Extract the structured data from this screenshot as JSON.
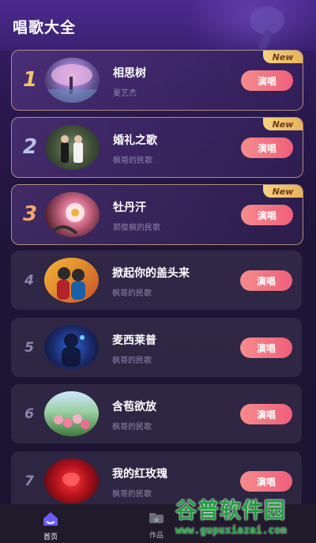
{
  "header": {
    "title": "唱歌大全"
  },
  "songs": [
    {
      "rank": "1",
      "title": "相思树",
      "artist": "夏艺杰",
      "button": "演唱",
      "badge": "New"
    },
    {
      "rank": "2",
      "title": "婚礼之歌",
      "artist": "枫哥的民歌",
      "button": "演唱",
      "badge": "New"
    },
    {
      "rank": "3",
      "title": "牡丹汗",
      "artist": "郭俊枫的民歌",
      "button": "演唱",
      "badge": "New"
    },
    {
      "rank": "4",
      "title": "掀起你的盖头来",
      "artist": "枫哥的民歌",
      "button": "演唱"
    },
    {
      "rank": "5",
      "title": "麦西莱普",
      "artist": "枫哥的民歌",
      "button": "演唱"
    },
    {
      "rank": "6",
      "title": "含苞欲放",
      "artist": "枫哥的民歌",
      "button": "演唱"
    },
    {
      "rank": "7",
      "title": "我的红玫瑰",
      "artist": "枫哥的民歌",
      "button": "演唱"
    }
  ],
  "tabs": [
    {
      "label": "首页",
      "icon": "home-icon"
    },
    {
      "label": "作品",
      "icon": "folder-icon"
    }
  ],
  "watermark": {
    "title": "谷普软件园",
    "url": "www.gupuxiazai.com"
  },
  "colors": {
    "rank1": "#f2c46b",
    "rank2": "#b8c3e6",
    "rank3": "#f3a86a",
    "sing_button": "#ef6b80",
    "badge": "#f0c46c"
  }
}
